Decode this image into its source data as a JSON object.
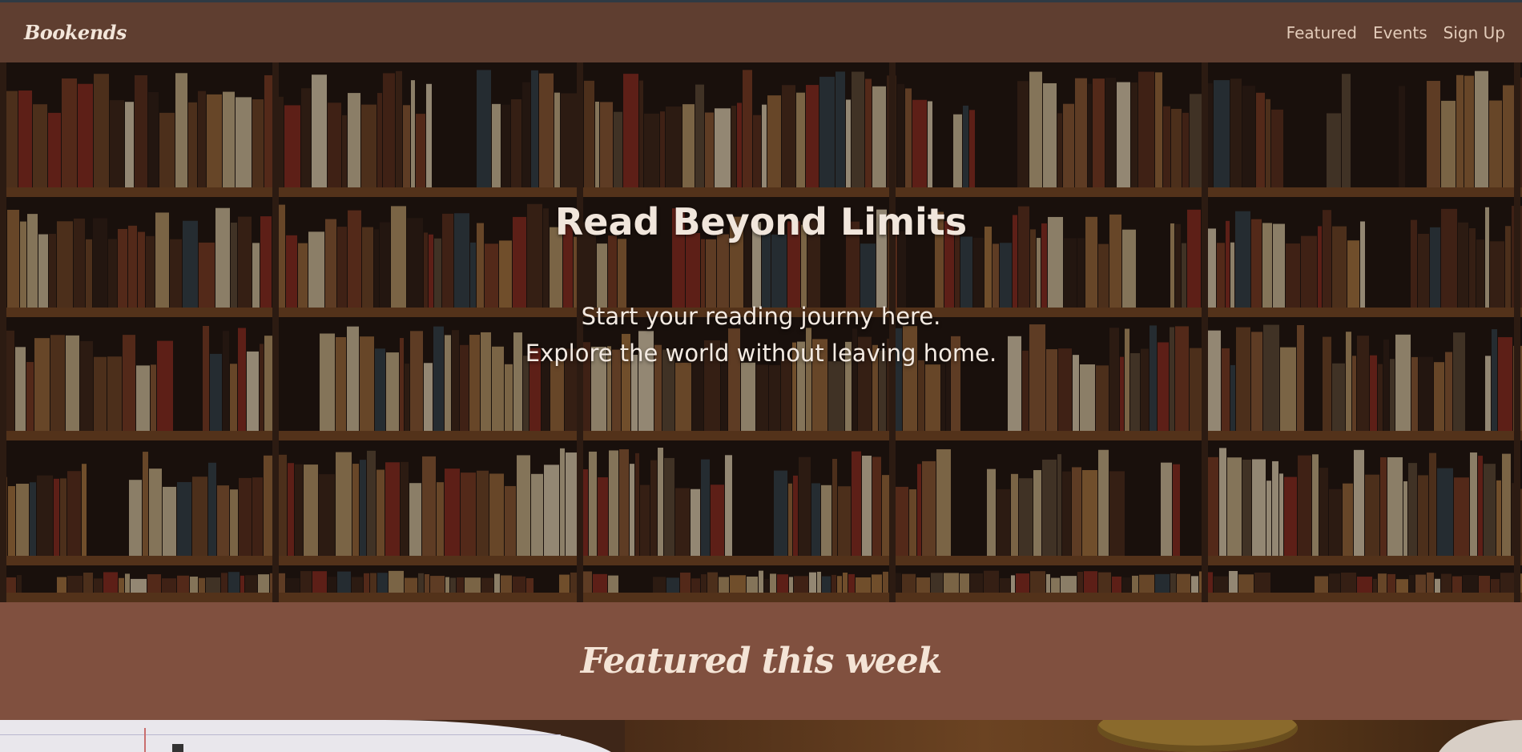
{
  "nav": {
    "brand": "Bookends",
    "links": [
      {
        "label": "Featured"
      },
      {
        "label": "Events"
      },
      {
        "label": "Sign Up"
      }
    ]
  },
  "hero": {
    "title": "Read Beyond Limits",
    "subtitle_line1": "Start your reading journy here.",
    "subtitle_line2": "Explore the world without leaving home."
  },
  "featured": {
    "title": "Featured this week"
  },
  "colors": {
    "navbar_bg": "#5f3e30",
    "featured_bg": "#80503f",
    "nav_text": "#e2cbb9",
    "heading_text": "#f3e6da"
  }
}
